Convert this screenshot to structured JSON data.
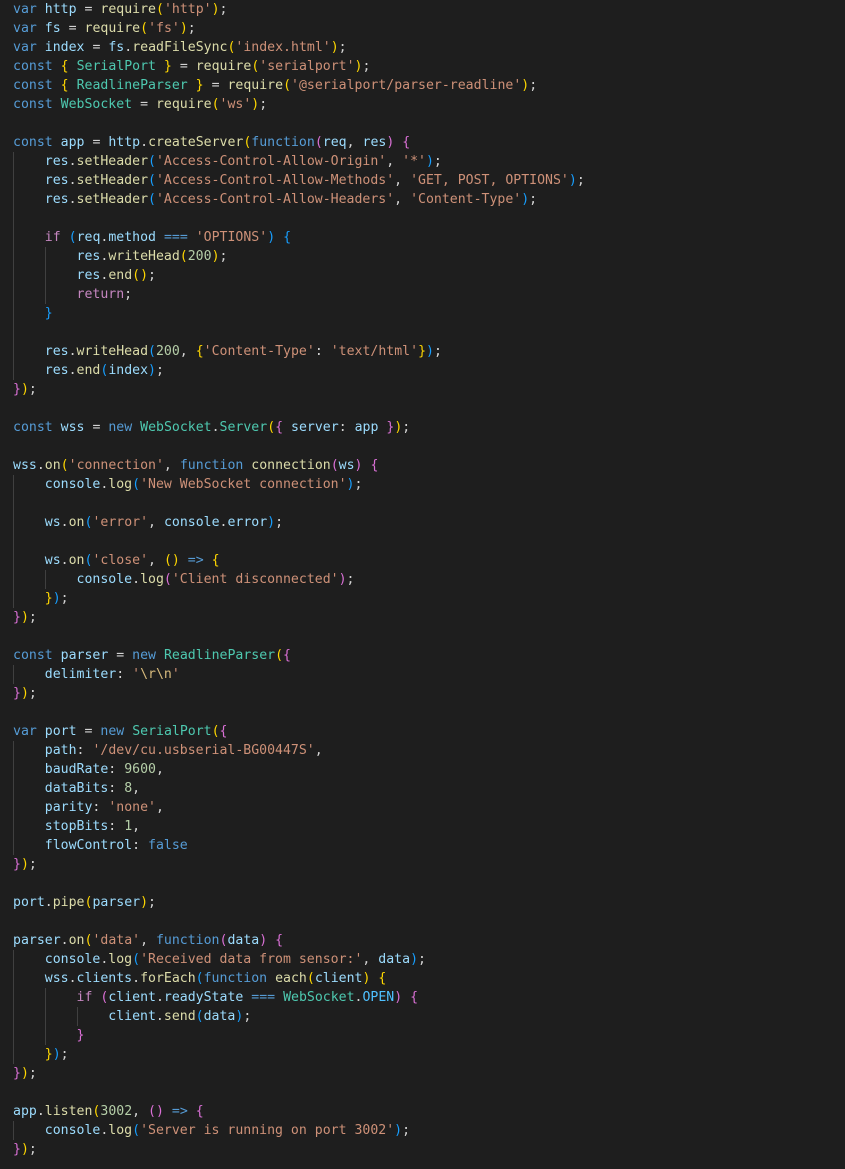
{
  "editor": {
    "language": "javascript",
    "lines": [
      "var http = require('http');",
      "var fs = require('fs');",
      "var index = fs.readFileSync('index.html');",
      "const { SerialPort } = require('serialport');",
      "const { ReadlineParser } = require('@serialport/parser-readline');",
      "const WebSocket = require('ws');",
      "",
      "const app = http.createServer(function(req, res) {",
      "    res.setHeader('Access-Control-Allow-Origin', '*');",
      "    res.setHeader('Access-Control-Allow-Methods', 'GET, POST, OPTIONS');",
      "    res.setHeader('Access-Control-Allow-Headers', 'Content-Type');",
      "",
      "    if (req.method === 'OPTIONS') {",
      "        res.writeHead(200);",
      "        res.end();",
      "        return;",
      "    }",
      "",
      "    res.writeHead(200, {'Content-Type': 'text/html'});",
      "    res.end(index);",
      "});",
      "",
      "const wss = new WebSocket.Server({ server: app });",
      "",
      "wss.on('connection', function connection(ws) {",
      "    console.log('New WebSocket connection');",
      "",
      "    ws.on('error', console.error);",
      "",
      "    ws.on('close', () => {",
      "        console.log('Client disconnected');",
      "    });",
      "});",
      "",
      "const parser = new ReadlineParser({",
      "    delimiter: '\\r\\n'",
      "});",
      "",
      "var port = new SerialPort({",
      "    path: '/dev/cu.usbserial-BG00447S',",
      "    baudRate: 9600,",
      "    dataBits: 8,",
      "    parity: 'none',",
      "    stopBits: 1,",
      "    flowControl: false",
      "});",
      "",
      "port.pipe(parser);",
      "",
      "parser.on('data', function(data) {",
      "    console.log('Received data from sensor:', data);",
      "    wss.clients.forEach(function each(client) {",
      "        if (client.readyState === WebSocket.OPEN) {",
      "            client.send(data);",
      "        }",
      "    });",
      "});",
      "",
      "app.listen(3002, () => {",
      "    console.log('Server is running on port 3002');",
      "});"
    ]
  },
  "colors": {
    "background": "#1e1e1e",
    "keyword": "#569cd6",
    "control": "#c586c0",
    "variable": "#9cdcfe",
    "class": "#4ec9b0",
    "constant": "#4fc1ff",
    "function": "#dcdcaa",
    "string": "#ce9178",
    "number": "#b5cea8",
    "bracket1": "#ffd700",
    "bracket2": "#da70d6",
    "bracket3": "#179fff"
  }
}
